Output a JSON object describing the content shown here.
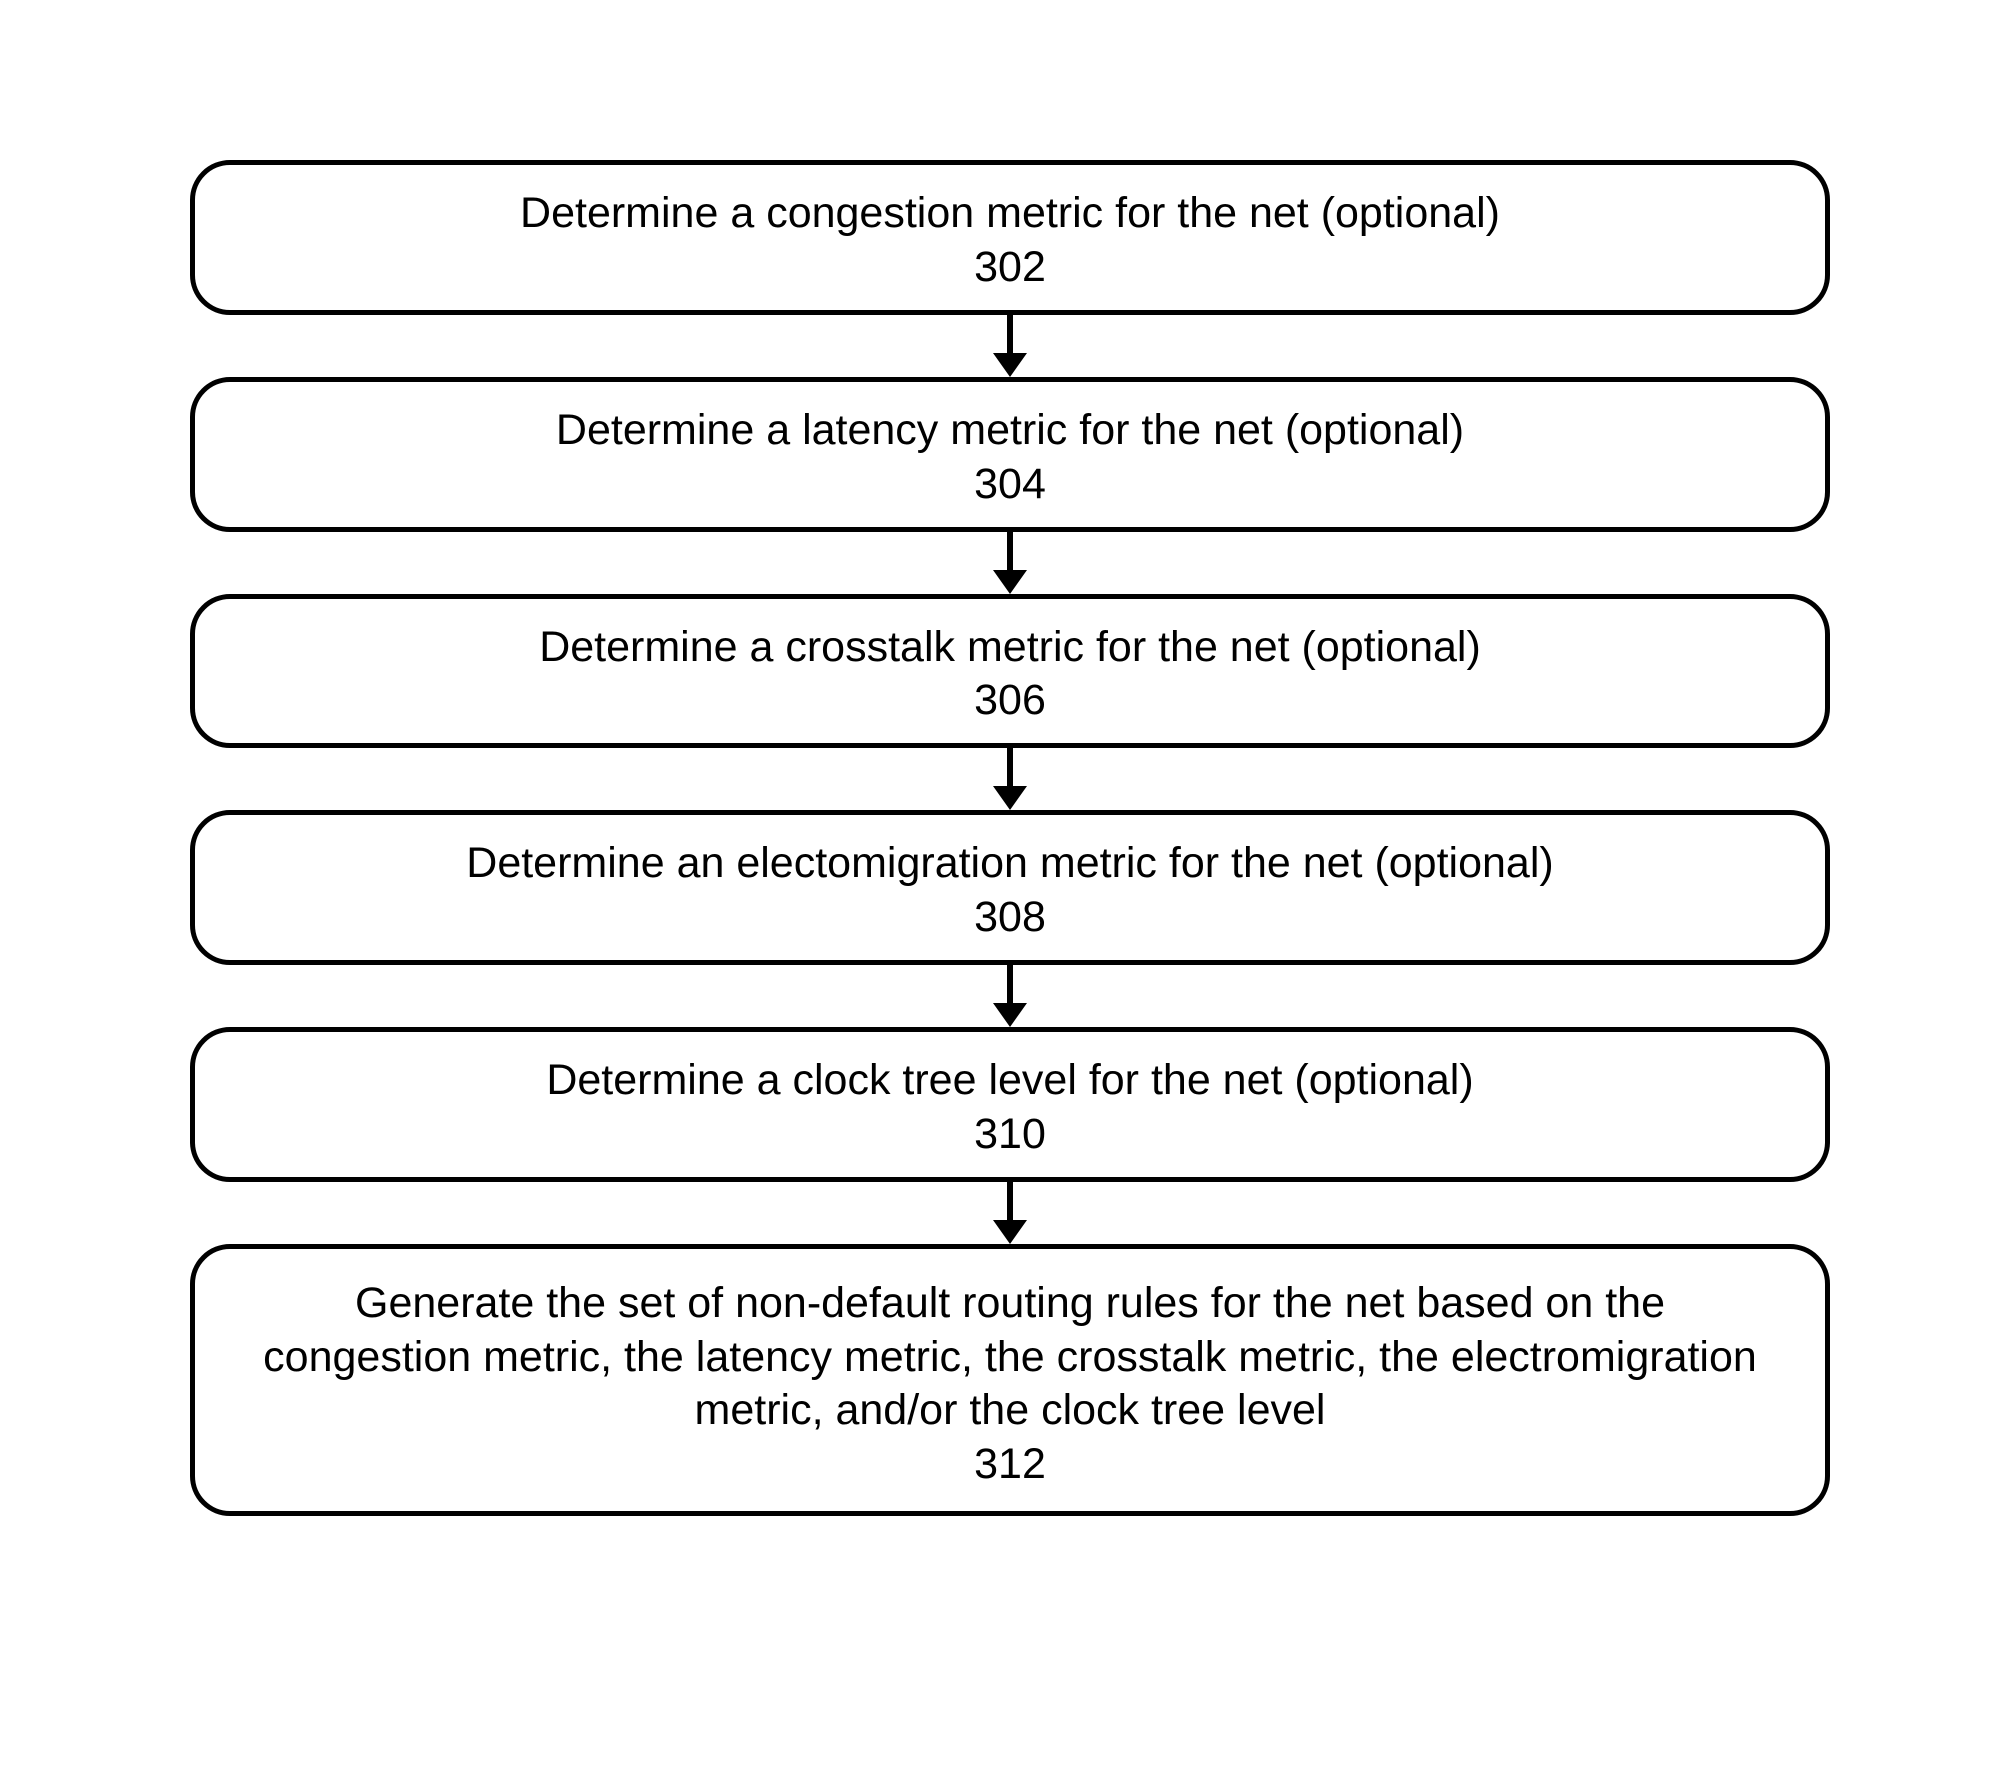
{
  "flowchart": {
    "steps": [
      {
        "text": "Determine a congestion metric for the net (optional)",
        "num": "302"
      },
      {
        "text": "Determine a latency metric for the net (optional)",
        "num": "304"
      },
      {
        "text": "Determine a crosstalk metric for the net (optional)",
        "num": "306"
      },
      {
        "text": "Determine an electomigration metric for the net (optional)",
        "num": "308"
      },
      {
        "text": "Determine a clock tree level for the net (optional)",
        "num": "310"
      },
      {
        "text": "Generate the set of non-default routing rules for the net based on the congestion metric, the latency metric, the crosstalk metric, the electromigration metric, and/or the clock tree level",
        "num": "312"
      }
    ]
  }
}
